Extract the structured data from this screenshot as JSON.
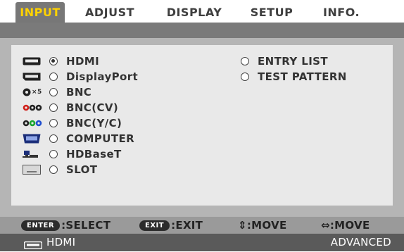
{
  "tabs": [
    {
      "label": "INPUT",
      "active": true
    },
    {
      "label": "ADJUST",
      "active": false
    },
    {
      "label": "DISPLAY",
      "active": false
    },
    {
      "label": "SETUP",
      "active": false
    },
    {
      "label": "INFO.",
      "active": false
    }
  ],
  "inputs": [
    {
      "label": "HDMI",
      "icon": "hdmi-icon",
      "selected": true
    },
    {
      "label": "DisplayPort",
      "icon": "displayport-icon",
      "selected": false
    },
    {
      "label": "BNC",
      "icon": "bnc-icon",
      "icon_text": "×5",
      "selected": false
    },
    {
      "label": "BNC(CV)",
      "icon": "bnc-cv-icon",
      "selected": false
    },
    {
      "label": "BNC(Y/C)",
      "icon": "bnc-yc-icon",
      "selected": false
    },
    {
      "label": "COMPUTER",
      "icon": "computer-icon",
      "selected": false
    },
    {
      "label": "HDBaseT",
      "icon": "hdbaset-icon",
      "selected": false
    },
    {
      "label": "SLOT",
      "icon": "slot-icon",
      "selected": false
    }
  ],
  "options": [
    {
      "label": "ENTRY LIST",
      "selected": false
    },
    {
      "label": "TEST PATTERN",
      "selected": false
    }
  ],
  "footer": {
    "enter_key": "ENTER",
    "enter_label": ":SELECT",
    "exit_key": "EXIT",
    "exit_label": ":EXIT",
    "move_v_label": "⇕:MOVE",
    "move_h_label": "⇔:MOVE"
  },
  "status": {
    "current_source": "HDMI",
    "mode": "ADVANCED"
  },
  "colors": {
    "active_tab_text": "#ffd200",
    "active_tab_bg": "#777777",
    "panel_bg": "#b5b5b5",
    "list_bg": "#e9e9e9",
    "status_bg": "#5a5a5a"
  }
}
